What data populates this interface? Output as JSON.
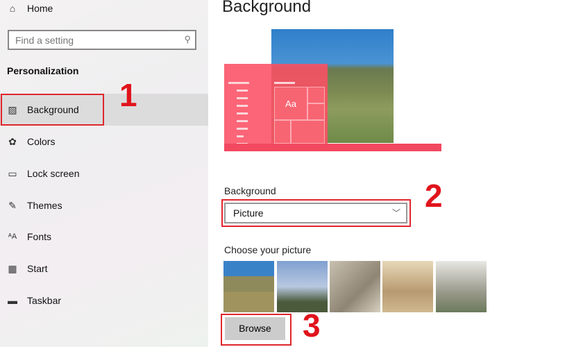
{
  "sidebar": {
    "home": "Home",
    "search_placeholder": "Find a setting",
    "section": "Personalization",
    "items": [
      {
        "label": "Background",
        "icon": "image-icon",
        "selected": true
      },
      {
        "label": "Colors",
        "icon": "palette-icon"
      },
      {
        "label": "Lock screen",
        "icon": "lock-screen-icon"
      },
      {
        "label": "Themes",
        "icon": "themes-icon"
      },
      {
        "label": "Fonts",
        "icon": "fonts-icon"
      },
      {
        "label": "Start",
        "icon": "start-icon"
      },
      {
        "label": "Taskbar",
        "icon": "taskbar-icon"
      }
    ]
  },
  "main": {
    "title": "Background",
    "preview_text": "Aa",
    "background_label": "Background",
    "background_value": "Picture",
    "choose_label": "Choose your picture",
    "browse": "Browse"
  },
  "annotations": [
    "1",
    "2",
    "3"
  ],
  "colors": {
    "accent": "#f24860",
    "annotation": "#e0141c"
  }
}
